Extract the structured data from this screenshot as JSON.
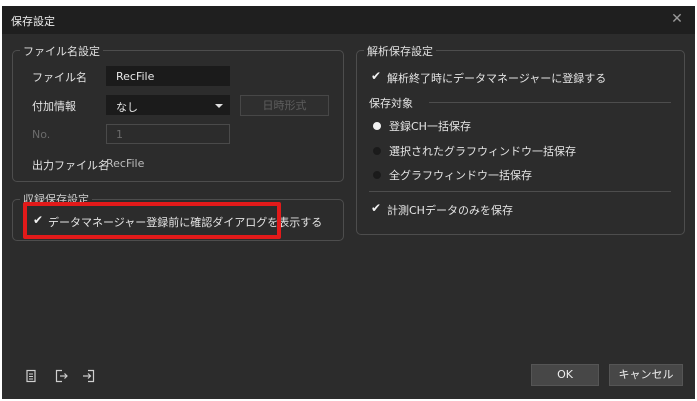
{
  "window": {
    "title": "保存設定"
  },
  "file_name_group": {
    "legend": "ファイル名設定",
    "file_name_label": "ファイル名",
    "file_name_value": "RecFile",
    "additional_info_label": "付加情報",
    "additional_info_value": "なし",
    "datetime_format_button": "日時形式",
    "no_label": "No.",
    "no_value": "1",
    "output_file_label": "出力ファイル名",
    "output_file_value": "RecFile"
  },
  "auto_save_group": {
    "legend": "収録保存設定",
    "confirm_dialog_label": "データマネージャー登録前に確認ダイアログを表示する",
    "confirm_dialog_checked": true
  },
  "analysis_group": {
    "legend": "解析保存設定",
    "register_label": "解析終了時にデータマネージャーに登録する",
    "register_checked": true,
    "save_target_label": "保存対象",
    "options": [
      {
        "label": "登録CH一括保存",
        "selected": true
      },
      {
        "label": "選択されたグラフウィンドウ一括保存",
        "selected": false
      },
      {
        "label": "全グラフウィンドウ一括保存",
        "selected": false
      }
    ],
    "measured_only_label": "計測CHデータのみを保存",
    "measured_only_checked": true
  },
  "footer": {
    "icons": [
      "document-icon",
      "export-icon",
      "import-icon"
    ],
    "ok_label": "OK",
    "cancel_label": "キャンセル"
  },
  "colors": {
    "highlight": "#e21a1a",
    "window_bg": "#2c2c2c",
    "titlebar_bg": "#1f1f1f"
  }
}
